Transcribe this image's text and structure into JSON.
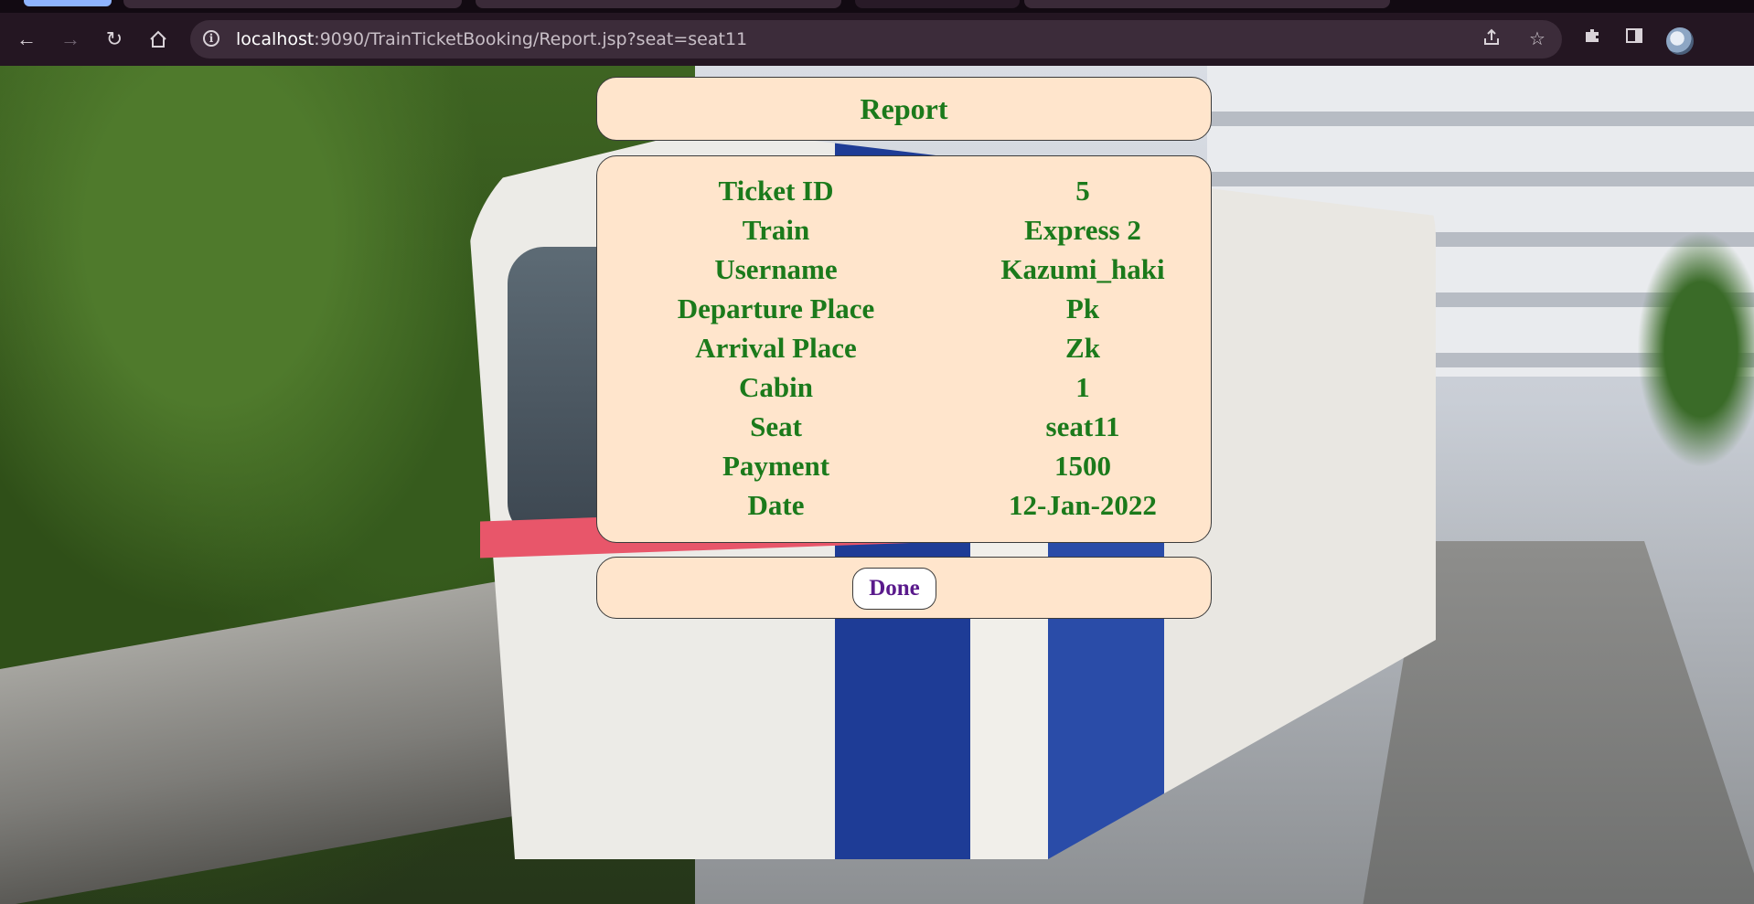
{
  "browser": {
    "url_host": "localhost",
    "url_rest": ":9090/TrainTicketBooking/Report.jsp?seat=seat11",
    "icons": {
      "back": "back-arrow-icon",
      "forward": "forward-arrow-icon",
      "reload": "reload-icon",
      "home": "home-icon",
      "info": "info-icon",
      "share": "share-icon",
      "star": "star-icon",
      "extensions": "puzzle-icon",
      "sidebar": "side-panel-icon",
      "profile": "avatar"
    }
  },
  "report": {
    "title": "Report",
    "rows": [
      {
        "label": "Ticket ID",
        "value": "5"
      },
      {
        "label": "Train",
        "value": "Express 2"
      },
      {
        "label": "Username",
        "value": "Kazumi_haki"
      },
      {
        "label": "Departure Place",
        "value": "Pk"
      },
      {
        "label": "Arrival Place",
        "value": "Zk"
      },
      {
        "label": "Cabin",
        "value": "1"
      },
      {
        "label": "Seat",
        "value": "seat11"
      },
      {
        "label": "Payment",
        "value": "1500"
      },
      {
        "label": "Date",
        "value": "12-Jan-2022"
      }
    ],
    "done_label": "Done"
  },
  "colors": {
    "panel_bg": "#ffe5cc",
    "text_green": "#1b7a1b",
    "button_text": "#5a1a8c",
    "chrome_bg": "#241622"
  }
}
